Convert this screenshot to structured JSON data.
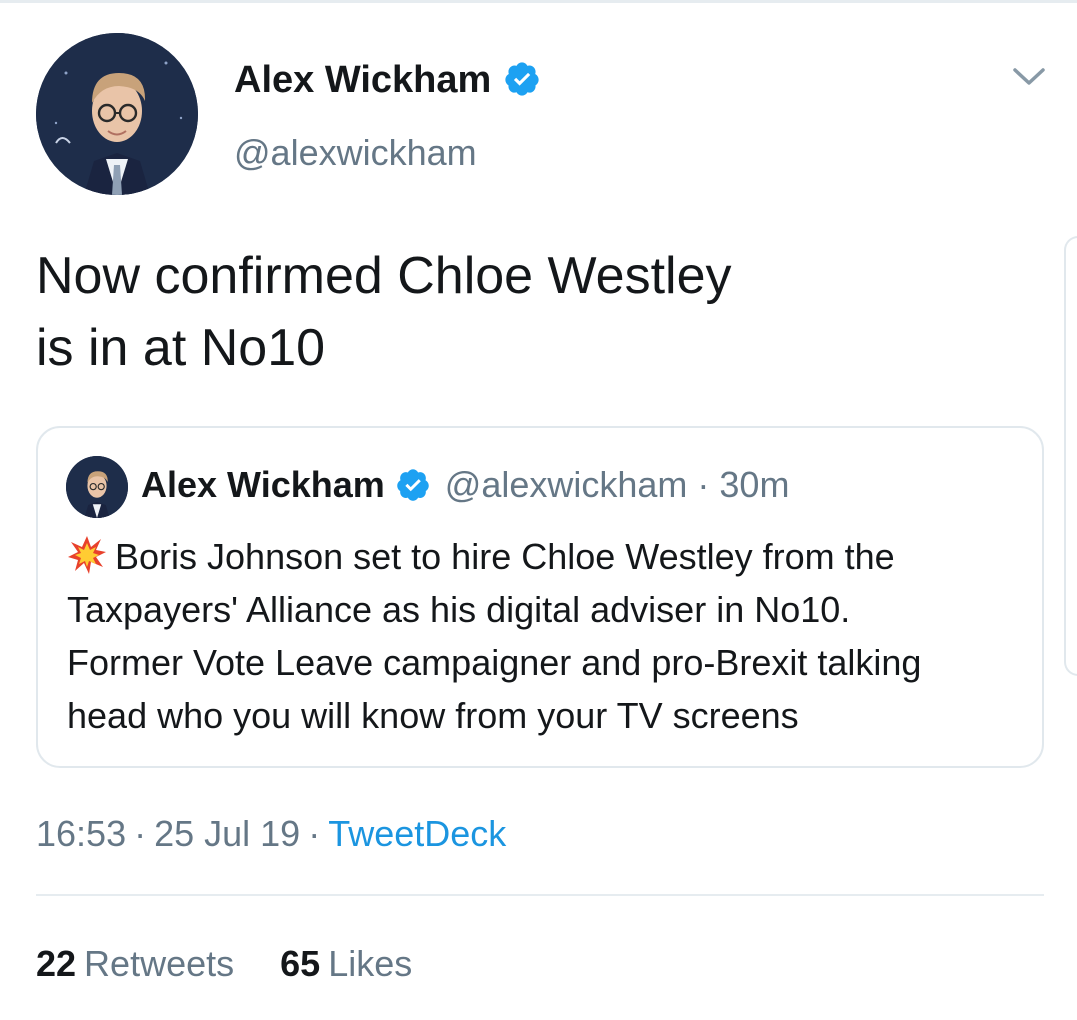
{
  "author": {
    "name": "Alex Wickham",
    "handle": "@alexwickham",
    "verified": true
  },
  "tweet": {
    "text_lines": [
      "Now confirmed Chloe Westley",
      "is in at No10"
    ]
  },
  "quoted_tweet": {
    "author_name": "Alex Wickham",
    "author_handle": "@alexwickham",
    "separator": "·",
    "age": "30m",
    "leading_icon": "collision-emoji-icon",
    "body_lines": [
      "Boris Johnson set to hire Chloe Westley from the",
      "Taxpayers' Alliance as his digital adviser in No10.",
      "Former Vote Leave campaigner and pro-Brexit talking",
      "head who you will know from your TV screens"
    ]
  },
  "meta": {
    "time": "16:53",
    "date": "25 Jul 19",
    "source": "TweetDeck",
    "separator": "·"
  },
  "stats": {
    "retweets_count": "22",
    "retweets_label": "Retweets",
    "likes_count": "65",
    "likes_label": "Likes"
  },
  "colors": {
    "text": "#14171a",
    "secondary": "#657786",
    "link": "#1b95e0",
    "verified": "#1da1f2",
    "border": "#e1e8ed"
  }
}
